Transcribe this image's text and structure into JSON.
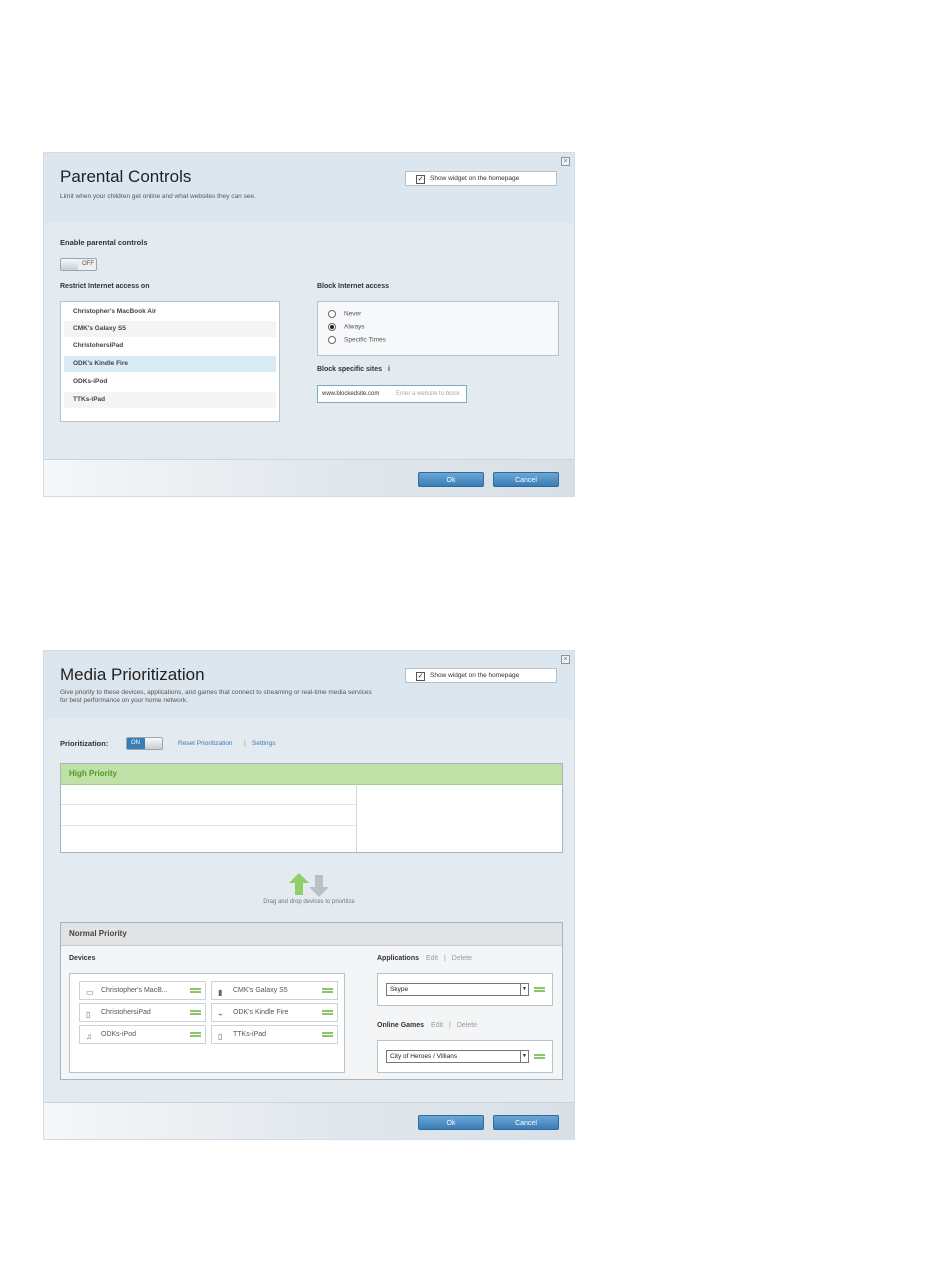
{
  "parental_controls": {
    "title": "Parental Controls",
    "subtitle": "Limit when your children get online and what websites they can see.",
    "show_widget_label": "Show widget on the homepage",
    "show_widget_checked": true,
    "enable_label": "Enable parental controls",
    "toggle_state": "OFF",
    "restrict_label": "Restrict Internet access on",
    "devices": [
      "Christopher's MacBook Air",
      "CMK's Galaxy S5",
      "ChristohersiPad",
      "ODK's Kindle Fire",
      "ODKs-iPod",
      "TTKs-iPad"
    ],
    "selected_device": "ODK's Kindle Fire",
    "block_label": "Block Internet access",
    "block_options": [
      "Never",
      "Always",
      "Specific Times"
    ],
    "block_selected": "Always",
    "block_sites_label": "Block specific sites",
    "block_sites_info": "i",
    "site_value": "www.blockedsite.com",
    "site_placeholder": "Enter a website to block",
    "ok_label": "Ok",
    "cancel_label": "Cancel",
    "close_glyph": "×"
  },
  "media_prioritization": {
    "title": "Media Prioritization",
    "subtitle": "Give priority to these devices, applications, and games that connect to streaming or real-time media services for best performance on your home network.",
    "show_widget_label": "Show widget on the homepage",
    "show_widget_checked": true,
    "prioritization_label": "Prioritization:",
    "toggle_state": "ON",
    "reset_label": "Reset Prioritization",
    "settings_label": "Settings",
    "high_priority_label": "High Priority",
    "drag_text": "Drag and drop devices to prioritize",
    "normal_priority_label": "Normal Priority",
    "devices_label": "Devices",
    "devices": [
      {
        "name": "Christopher's MacB...",
        "icon": "laptop-icon"
      },
      {
        "name": "CMK's Galaxy S5",
        "icon": "phone-icon"
      },
      {
        "name": "ChristohersiPad",
        "icon": "tablet-icon"
      },
      {
        "name": "ODK's Kindle Fire",
        "icon": "ereader-icon"
      },
      {
        "name": "ODKs-iPod",
        "icon": "media-player-icon"
      },
      {
        "name": "TTKs-iPad",
        "icon": "tablet-icon"
      }
    ],
    "applications_label": "Applications",
    "app_edit": "Edit",
    "app_delete": "Delete",
    "application_selected": "Skype",
    "games_label": "Online Games",
    "games_edit": "Edit",
    "games_delete": "Delete",
    "game_selected": "City of Heroes / Villians",
    "ok_label": "Ok",
    "cancel_label": "Cancel",
    "close_glyph": "×"
  },
  "colors": {
    "accent_blue": "#3a7cb6",
    "high_priority_green": "#bfe0a6",
    "grip_green": "#8cc46a"
  }
}
